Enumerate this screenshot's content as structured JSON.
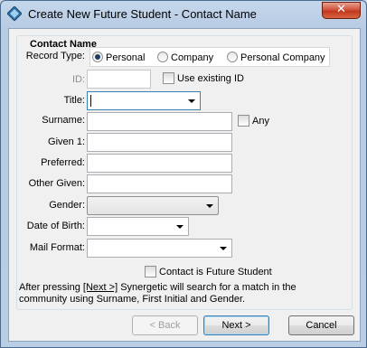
{
  "window": {
    "title": "Create New Future Student - Contact Name",
    "close_glyph": "✕"
  },
  "group": {
    "title": "Contact Name"
  },
  "record_type": {
    "label": "Record Type:",
    "options": [
      {
        "label": "Personal",
        "selected": true
      },
      {
        "label": "Company",
        "selected": false
      },
      {
        "label": "Personal Company",
        "selected": false
      }
    ]
  },
  "id_field": {
    "label": "ID:",
    "value": "",
    "use_existing_label": "Use existing ID",
    "use_existing_checked": false
  },
  "title_field": {
    "label": "Title:",
    "value": ""
  },
  "surname": {
    "label": "Surname:",
    "value": "",
    "any_label": "Any",
    "any_checked": false
  },
  "given1": {
    "label": "Given 1:",
    "value": ""
  },
  "preferred": {
    "label": "Preferred:",
    "value": ""
  },
  "other_given": {
    "label": "Other Given:",
    "value": ""
  },
  "gender": {
    "label": "Gender:",
    "value": ""
  },
  "dob": {
    "label": "Date of Birth:",
    "value": ""
  },
  "mail_format": {
    "label": "Mail Format:",
    "value": ""
  },
  "future_student": {
    "label": "Contact is Future Student",
    "checked": false
  },
  "info": {
    "line1_prefix": "After pressing ",
    "line1_link": "[Next >]",
    "line1_suffix": " Synergetic will search for a match in the",
    "line2": "community using Surname, First Initial and Gender."
  },
  "buttons": {
    "back": "< Back",
    "next": "Next >",
    "cancel": "Cancel"
  },
  "colors": {
    "accent": "#3c7fb1",
    "radio_dot": "#1f3a68",
    "close": "#c2371d"
  }
}
